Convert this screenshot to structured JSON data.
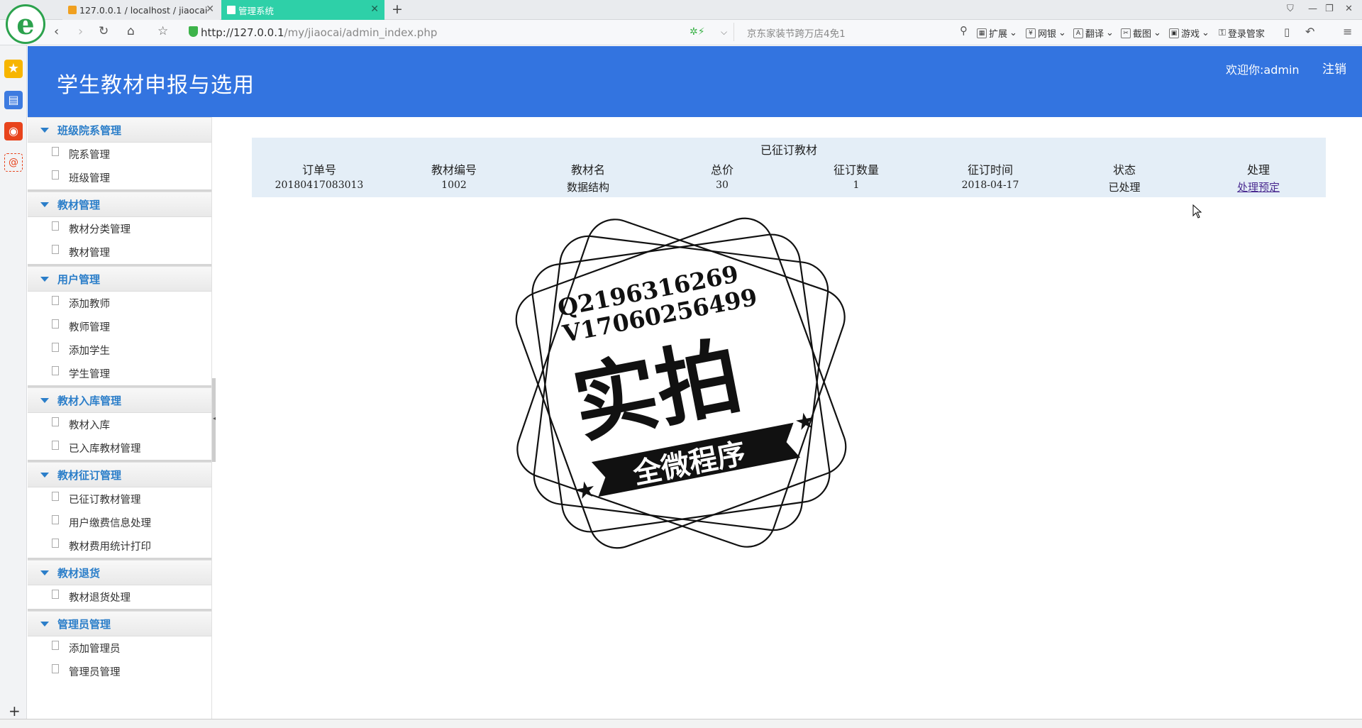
{
  "browser": {
    "tabs": [
      {
        "label": "127.0.0.1 / localhost / jiaocai",
        "active": false
      },
      {
        "label": "管理系统",
        "active": true
      }
    ],
    "url_host": "http://127.0.0.1",
    "url_path": "/my/jiaocai/admin_index.php",
    "search_placeholder": "京东家装节跨万店4免1",
    "tools": [
      "扩展",
      "网银",
      "翻译",
      "截图",
      "游戏",
      "登录管家"
    ]
  },
  "header": {
    "title": "学生教材申报与选用",
    "welcome": "欢迎你:admin",
    "logout": "注销"
  },
  "menu": [
    {
      "group": "班级院系管理",
      "items": [
        "院系管理",
        "班级管理"
      ]
    },
    {
      "group": "教材管理",
      "items": [
        "教材分类管理",
        "教材管理"
      ]
    },
    {
      "group": "用户管理",
      "items": [
        "添加教师",
        "教师管理",
        "添加学生",
        "学生管理"
      ]
    },
    {
      "group": "教材入库管理",
      "items": [
        "教材入库",
        "已入库教材管理"
      ]
    },
    {
      "group": "教材征订管理",
      "items": [
        "已征订教材管理",
        "用户缴费信息处理",
        "教材费用统计打印"
      ]
    },
    {
      "group": "教材退货",
      "items": [
        "教材退货处理"
      ]
    },
    {
      "group": "管理员管理",
      "items": [
        "添加管理员",
        "管理员管理"
      ]
    }
  ],
  "orders": {
    "caption": "已征订教材",
    "columns": [
      "订单号",
      "教材编号",
      "教材名",
      "总价",
      "征订数量",
      "征订时间",
      "状态",
      "处理"
    ],
    "rows": [
      {
        "order_no": "20180417083013",
        "book_no": "1002",
        "book_name": "数据结构",
        "total": "30",
        "qty": "1",
        "date": "2018-04-17",
        "status": "已处理",
        "action": "处理预定"
      }
    ]
  },
  "watermark": {
    "line1": "Q2196316269",
    "line2": "V17060256499",
    "big": "实拍",
    "ribbon": "全微程序"
  }
}
